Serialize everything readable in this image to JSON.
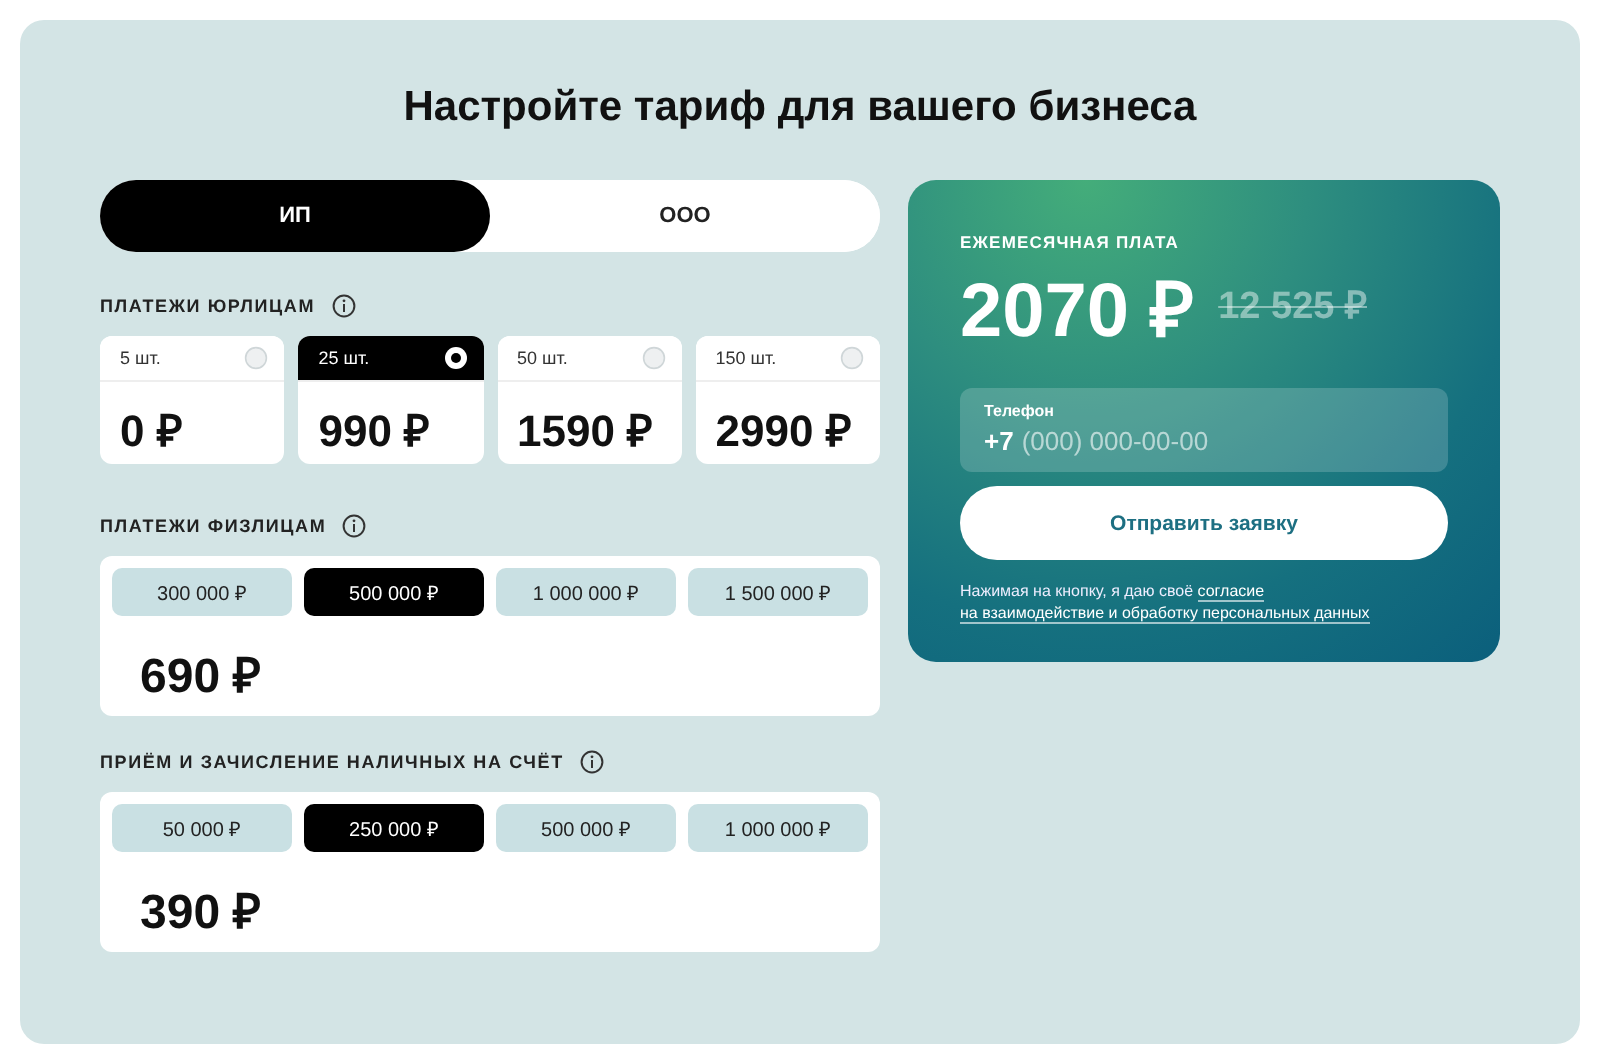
{
  "title": "Настройте тариф для вашего бизнеса",
  "business_type": [
    {
      "label": "ИП",
      "selected": true
    },
    {
      "label": "ООО",
      "selected": false
    }
  ],
  "legal_payments": {
    "label": "ПЛАТЕЖИ ЮРЛИЦАМ",
    "options": [
      {
        "count": "5 шт.",
        "price": "0 ₽",
        "selected": false
      },
      {
        "count": "25 шт.",
        "price": "990 ₽",
        "selected": true
      },
      {
        "count": "50 шт.",
        "price": "1590 ₽",
        "selected": false
      },
      {
        "count": "150 шт.",
        "price": "2990 ₽",
        "selected": false
      }
    ]
  },
  "chip_sections": [
    {
      "label": "ПЛАТЕЖИ ФИЗЛИЦАМ",
      "price": "690 ₽",
      "options": [
        {
          "label": "300 000 ₽",
          "selected": false
        },
        {
          "label": "500 000 ₽",
          "selected": true
        },
        {
          "label": "1 000 000 ₽",
          "selected": false
        },
        {
          "label": "1 500 000 ₽",
          "selected": false
        }
      ]
    },
    {
      "label": "ПРИЁМ И ЗАЧИСЛЕНИЕ НАЛИЧНЫХ НА СЧЁТ",
      "price": "390 ₽",
      "options": [
        {
          "label": "50 000 ₽",
          "selected": false
        },
        {
          "label": "250 000 ₽",
          "selected": true
        },
        {
          "label": "500 000 ₽",
          "selected": false
        },
        {
          "label": "1 000 000 ₽",
          "selected": false
        }
      ]
    }
  ],
  "summary": {
    "label": "ЕЖЕМЕСЯЧНАЯ ПЛАТА",
    "price": "2070 ₽",
    "old_price": "12 525 ₽",
    "phone": {
      "label": "Телефон",
      "prefix": "+7",
      "placeholder": "(000) 000-00-00"
    },
    "button": "Отправить заявку",
    "consent": {
      "text": "Нажимая на кнопку, я даю своё",
      "link_parts": [
        "согласие",
        "на взаимодействие и обработку персональных данных"
      ]
    }
  }
}
